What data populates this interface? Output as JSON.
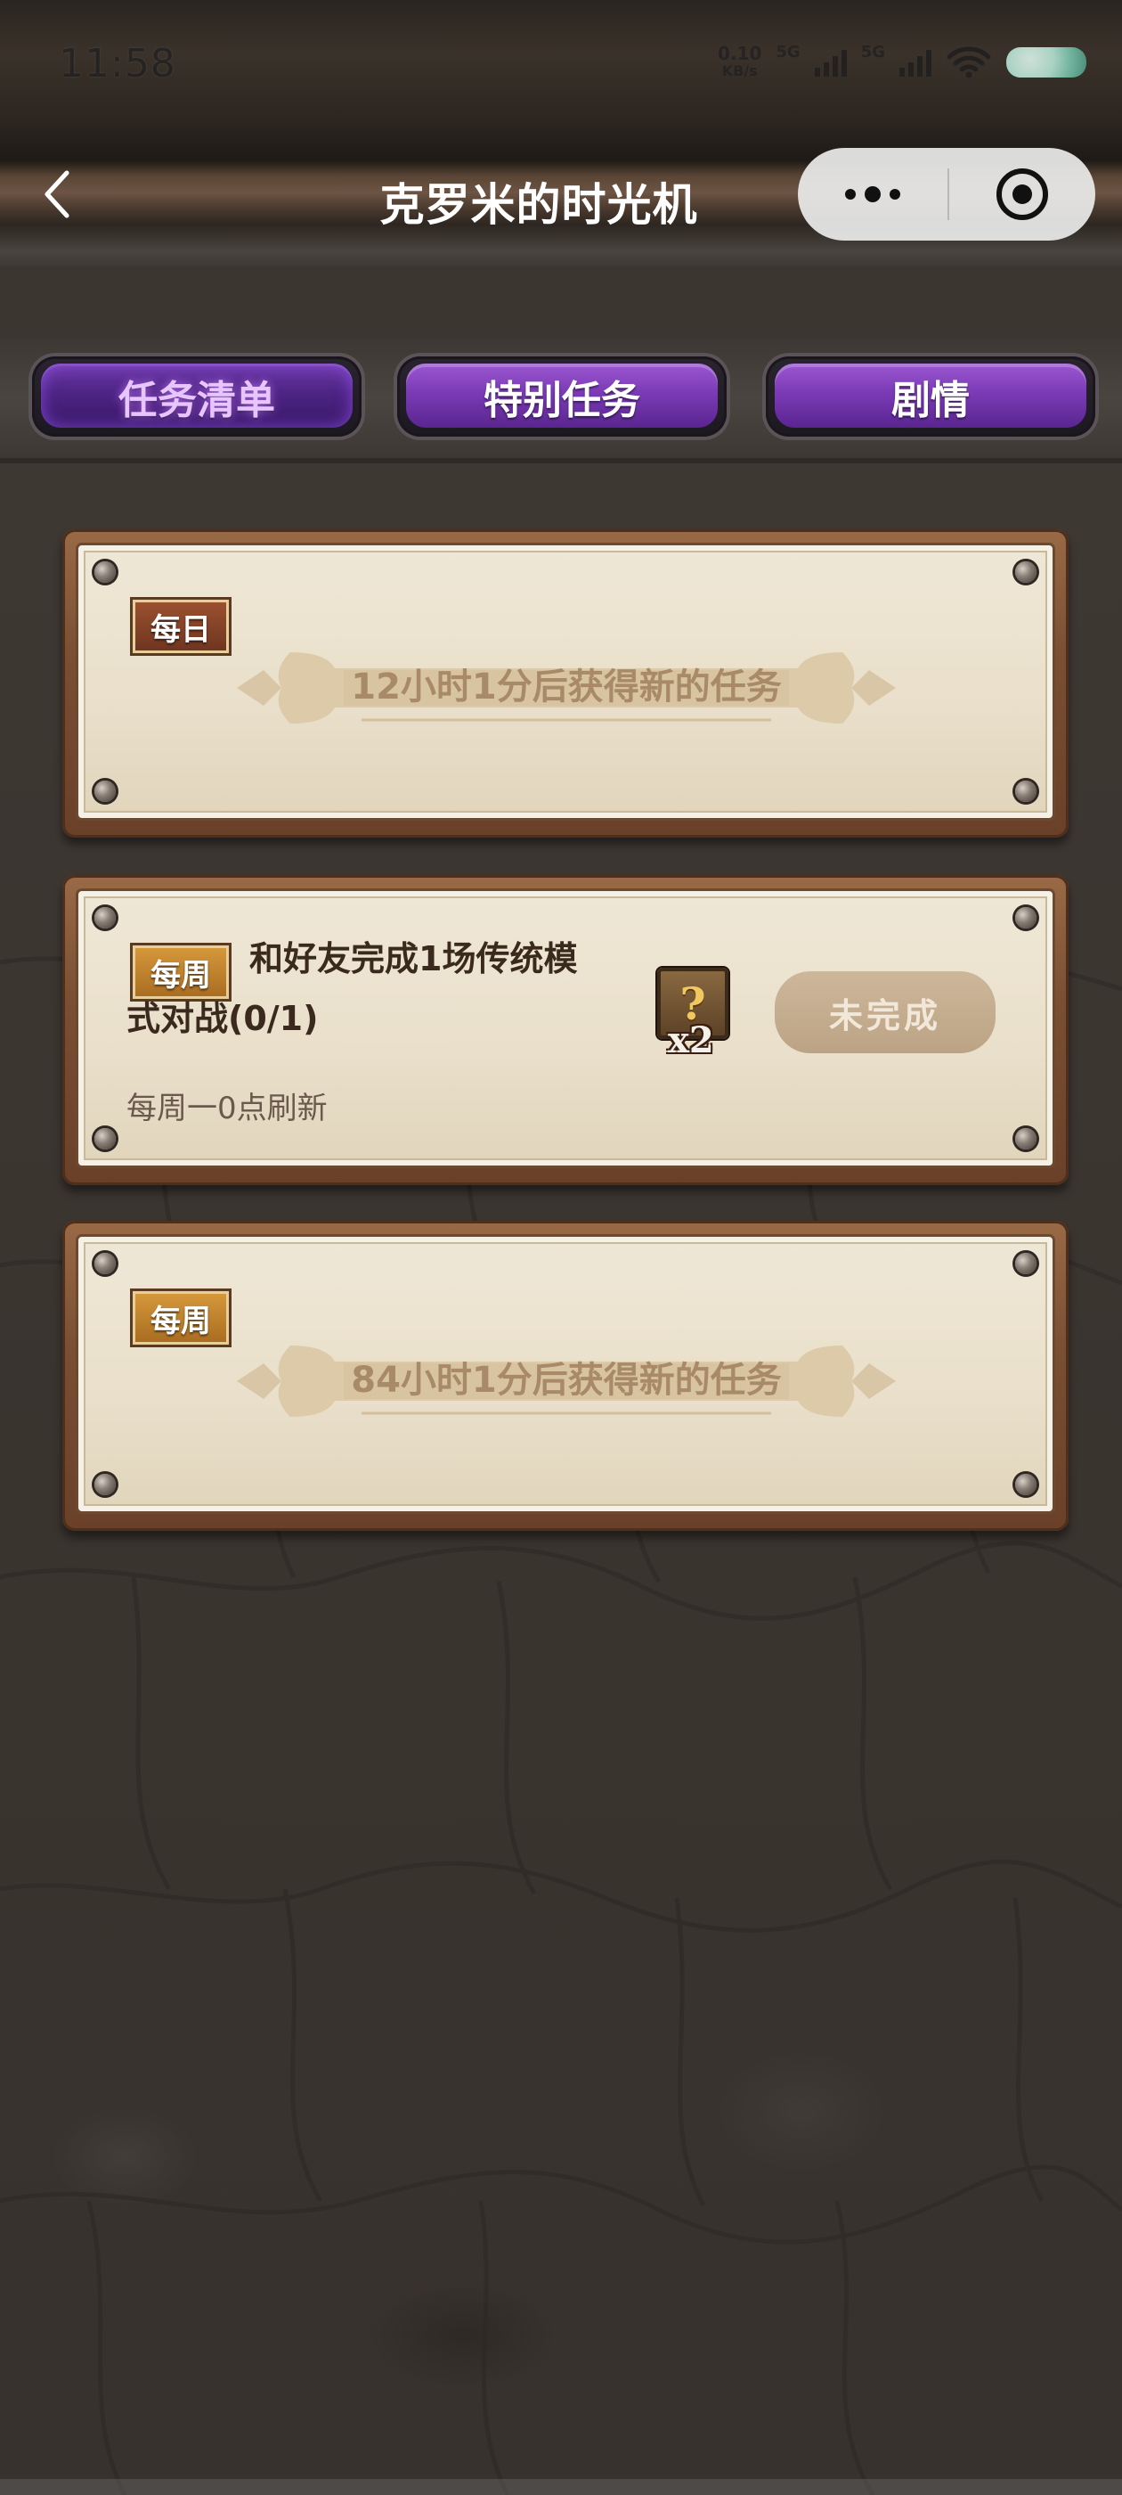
{
  "status_bar": {
    "time": "11:58",
    "net_speed_value": "0.10",
    "net_speed_unit": "KB/s",
    "signal_1": "5G",
    "signal_2": "5G"
  },
  "nav": {
    "title": "克罗米的时光机"
  },
  "tabs": [
    {
      "label": "任务清单",
      "active": true
    },
    {
      "label": "特别任务",
      "active": false
    },
    {
      "label": "剧情",
      "active": false
    }
  ],
  "tasks": [
    {
      "tag": "每日",
      "message": "12小时1分后获得新的任务"
    },
    {
      "tag": "每周",
      "title_line1": "和好友完成1场传统模",
      "title_line2": "式对战(0/1)",
      "refresh": "每周一0点刷新",
      "reward_icon_text": "?",
      "reward_count": "x2",
      "status": "未完成"
    },
    {
      "tag": "每周",
      "message": "84小时1分后获得新的任务"
    }
  ],
  "colors": {
    "tab_purple": "#7b3bb6",
    "tag_daily": "#9d5230",
    "tag_weekly": "#d79a3c",
    "paper": "#ece3d1",
    "frame_wood": "#7a4f33"
  }
}
